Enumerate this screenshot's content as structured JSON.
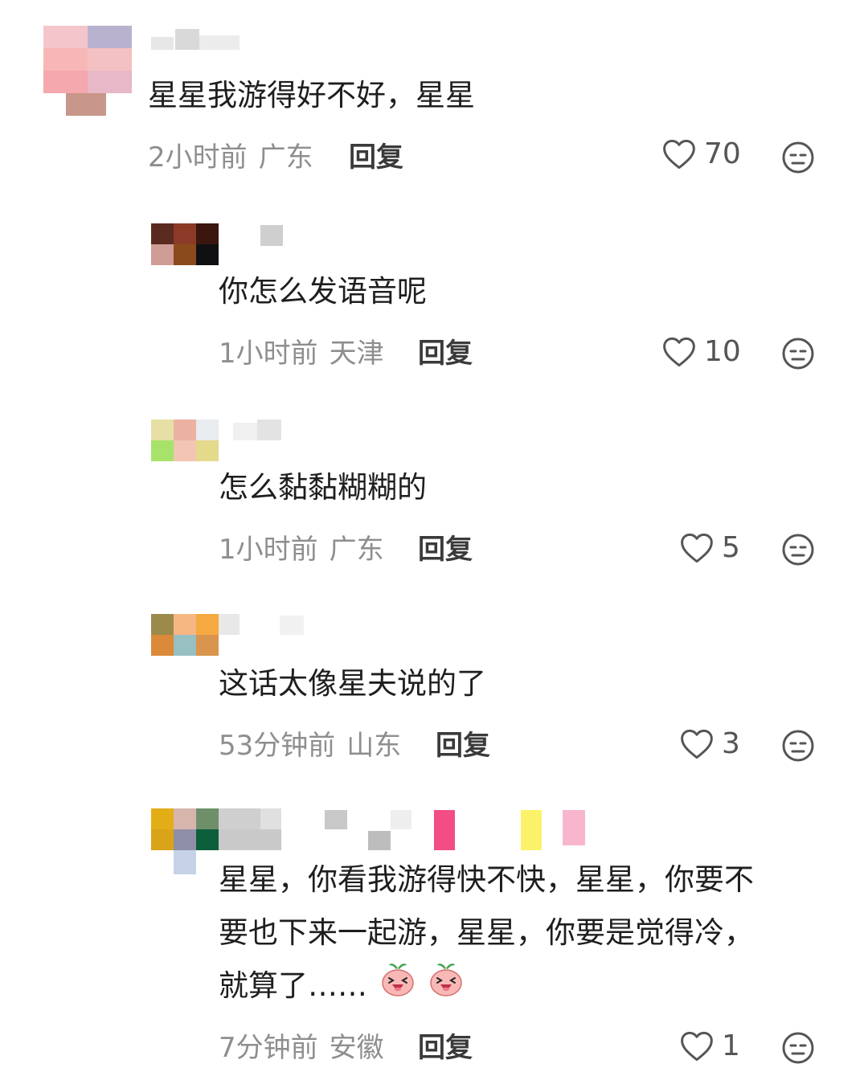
{
  "comments": [
    {
      "text": "星星我游得好不好，星星",
      "time": "2小时前",
      "location": "广东",
      "reply": "回复",
      "likes": "70"
    },
    {
      "text": "你怎么发语音呢",
      "time": "1小时前",
      "location": "天津",
      "reply": "回复",
      "likes": "10"
    },
    {
      "text": "怎么黏黏糊糊的",
      "time": "1小时前",
      "location": "广东",
      "reply": "回复",
      "likes": "5"
    },
    {
      "text": "这话太像星夫说的了",
      "time": "53分钟前",
      "location": "山东",
      "reply": "回复",
      "likes": "3"
    },
    {
      "text_lines": [
        "星星，你看我游得快不快，星星，你要不",
        "要也下来一起游，星星，你要是觉得冷，",
        "就算了……"
      ],
      "time": "7分钟前",
      "location": "安徽",
      "reply": "回复",
      "likes": "1"
    }
  ],
  "icons": {
    "like": "heart-outline-icon",
    "more": "neutral-face-icon",
    "emoji": "laughing-peach-emoji-icon"
  },
  "colors": {
    "text": "#1e1e1e",
    "meta": "#8e8e8e",
    "icon": "#555555"
  }
}
